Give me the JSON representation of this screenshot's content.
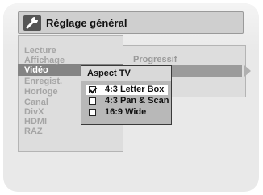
{
  "window": {
    "title": "Réglage général",
    "title_icon": "wrench-icon"
  },
  "menu": {
    "items": [
      {
        "label": "Lecture",
        "active": false
      },
      {
        "label": "Affichage",
        "active": false
      },
      {
        "label": "Vidéo",
        "active": true
      },
      {
        "label": "Enregist.",
        "active": false
      },
      {
        "label": "Horloge",
        "active": false
      },
      {
        "label": "Canal",
        "active": false
      },
      {
        "label": "DivX",
        "active": false
      },
      {
        "label": "HDMI",
        "active": false
      },
      {
        "label": "RAZ",
        "active": false
      }
    ]
  },
  "video_settings": {
    "progressive_label": "Progressif",
    "arrow_icon": "arrow-right-icon"
  },
  "aspect_menu": {
    "title": "Aspect TV",
    "options": [
      {
        "label": "4:3 Letter Box",
        "checked": true,
        "selected": true
      },
      {
        "label": "4:3 Pan & Scan",
        "checked": false,
        "selected": false
      },
      {
        "label": "16:9 Wide",
        "checked": false,
        "selected": false
      }
    ]
  },
  "colors": {
    "highlight": "#848484",
    "panel": "#dddddd",
    "background": "#e9e9e9"
  }
}
